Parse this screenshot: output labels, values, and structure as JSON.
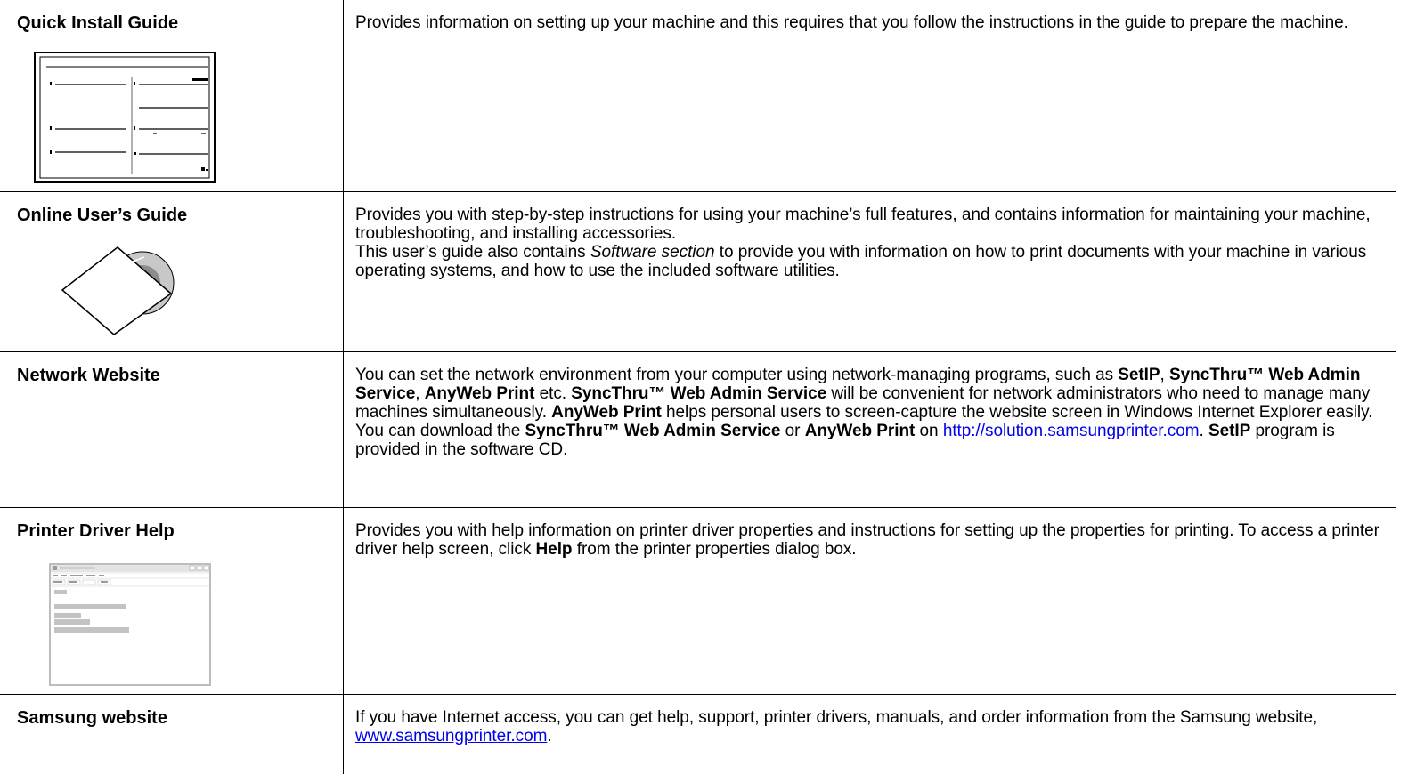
{
  "rows": [
    {
      "label": "Quick Install Guide",
      "desc": "Provides information on setting up your machine and this requires that you follow the instructions in the guide to prepare the machine.",
      "thumb_icon": "install-guide-sheet"
    },
    {
      "label": "Online User’s Guide",
      "desc_1": "Provides you with step-by-step instructions for using your machine’s full features, and contains information for maintaining your machine, troubleshooting, and installing accessories.",
      "desc_2a": "This user’s guide also contains ",
      "desc_2_italic": "Software section",
      "desc_2b": " to provide you with information on how to print documents with your machine in various operating systems, and how to use the included software utilities.",
      "thumb_icon": "cd-in-sleeve"
    },
    {
      "label": "Network Website",
      "p1": "You can set the network environment from your computer using network-managing programs, such as ",
      "b1": "SetIP",
      "p2": ", ",
      "b2": "SyncThru™ Web Admin Service",
      "p3": ", ",
      "b3": "AnyWeb Print",
      "p4": " etc. ",
      "b4": "SyncThru™ Web Admin Service",
      "p5": " will be convenient for network administrators who need to manage many machines simultaneously. ",
      "b5": "AnyWeb Print",
      "p6": " helps personal users to screen-capture the website screen in Windows Internet Explorer easily. You can download the ",
      "b6": "SyncThru™ Web Admin Service",
      "p7": " or ",
      "b7": "AnyWeb Print",
      "p8": " on ",
      "link": "http://solution.samsungprinter.com",
      "p9": ". ",
      "b8": "SetIP",
      "p10": " program is provided in the software CD."
    },
    {
      "label": "Printer Driver Help",
      "p1": "Provides you with help information on printer driver properties and instructions for setting up the properties for printing. To access a printer driver help screen, click ",
      "b1": "Help",
      "p2": " from the printer properties dialog box.",
      "thumb_icon": "help-window-screenshot"
    },
    {
      "label": "Samsung website",
      "p1": "If you have Internet access, you can get help, support, printer drivers, manuals, and order information from the Samsung website, ",
      "link": "www.samsungprinter.com",
      "p2": "."
    }
  ]
}
